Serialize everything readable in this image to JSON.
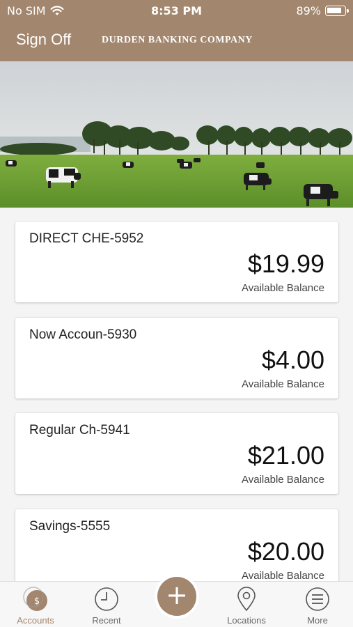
{
  "status": {
    "carrier": "No SIM",
    "time": "8:53 PM",
    "battery": "89%",
    "battery_level": 0.89
  },
  "header": {
    "signoff_label": "Sign Off",
    "brand": "DURDEN BANKING COMPANY",
    "color": "#a2866e"
  },
  "accounts": [
    {
      "name": "DIRECT CHE-5952",
      "amount": "$19.99",
      "label": "Available Balance"
    },
    {
      "name": "Now Accoun-5930",
      "amount": "$4.00",
      "label": "Available Balance"
    },
    {
      "name": "Regular Ch-5941",
      "amount": "$21.00",
      "label": "Available Balance"
    },
    {
      "name": "Savings-5555",
      "amount": "$20.00",
      "label": "Available Balance"
    }
  ],
  "tabs": [
    {
      "label": "Accounts",
      "icon": "dollar-icon",
      "active": true
    },
    {
      "label": "Recent",
      "icon": "clock-icon",
      "active": false
    },
    {
      "label": "Locations",
      "icon": "map-pin-icon",
      "active": false
    },
    {
      "label": "More",
      "icon": "menu-icon",
      "active": false
    }
  ],
  "fab": {
    "symbol": "+",
    "icon": "add-icon"
  }
}
